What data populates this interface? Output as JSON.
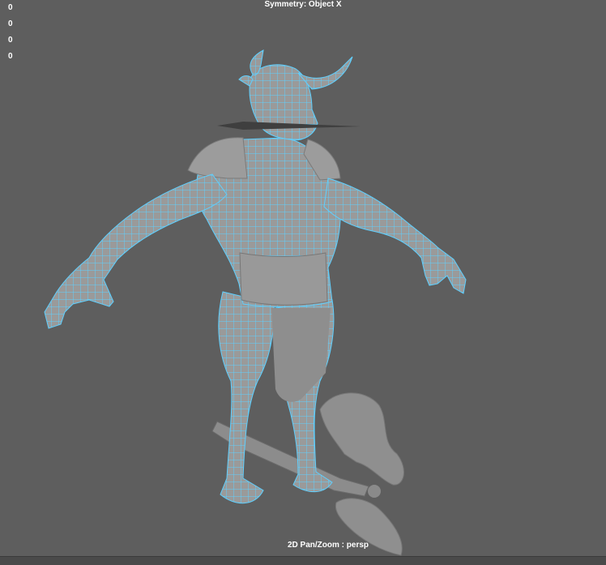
{
  "hud": {
    "counts": [
      "0",
      "0",
      "0",
      "0"
    ],
    "symmetry": "Symmetry: Object X",
    "camera_status": "2D Pan/Zoom : persp"
  },
  "colors": {
    "background": "#5e5e5e",
    "wireframe": "#5fd0ff",
    "mesh": "#9e9e9e"
  }
}
